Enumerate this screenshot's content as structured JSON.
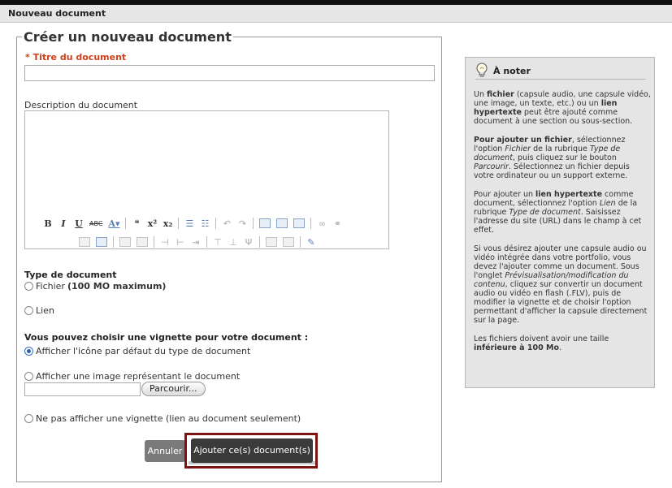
{
  "header": {
    "title": "Nouveau document"
  },
  "form": {
    "legend": "Créer un nouveau document",
    "title_label": "* Titre du document",
    "title_value": "",
    "description_label": "Description du document",
    "description_value": "",
    "doc_type": {
      "heading": "Type de document",
      "option_file": "Fichier",
      "option_file_note": "(100 MO maximum)",
      "option_link": "Lien"
    },
    "thumbnail": {
      "heading": "Vous pouvez choisir une vignette pour votre document :",
      "option_default": "Afficher l'icône par défaut du type de document",
      "option_image": "Afficher une image représentant le document",
      "browse_label": "Parcourir...",
      "option_none": "Ne pas afficher une vignette (lien au document seulement)",
      "selected": "option_default"
    },
    "cancel_label": "Annuler",
    "submit_label": "Ajouter ce(s) document(s)"
  },
  "toolbar": {
    "row1": [
      {
        "name": "bold-icon",
        "glyph": "B",
        "cls": "bold"
      },
      {
        "name": "italic-icon",
        "glyph": "I",
        "cls": "ital"
      },
      {
        "name": "underline-icon",
        "glyph": "U",
        "cls": "under"
      },
      {
        "name": "strikethrough-icon",
        "glyph": "ABC",
        "cls": "strike"
      },
      {
        "name": "font-color-icon",
        "glyph": "A▾",
        "cls": "under blue"
      },
      {
        "sep": true
      },
      {
        "name": "blockquote-icon",
        "glyph": "❝",
        "cls": ""
      },
      {
        "name": "superscript-icon",
        "glyph": "x²",
        "cls": "bold"
      },
      {
        "name": "subscript-icon",
        "glyph": "x₂",
        "cls": "bold"
      },
      {
        "sep": true
      },
      {
        "name": "bullet-list-icon",
        "glyph": "☰",
        "cls": "blue"
      },
      {
        "name": "numbered-list-icon",
        "glyph": "☷",
        "cls": "blue"
      },
      {
        "sep": true
      },
      {
        "name": "undo-icon",
        "glyph": "↶",
        "cls": "dim"
      },
      {
        "name": "redo-icon",
        "glyph": "↷",
        "cls": "dim"
      },
      {
        "sep": true
      },
      {
        "name": "paste-icon",
        "glyph": "",
        "cls": "icon"
      },
      {
        "name": "paste-text-icon",
        "glyph": "",
        "cls": "icon"
      },
      {
        "name": "paste-word-icon",
        "glyph": "",
        "cls": "icon"
      },
      {
        "sep": true
      },
      {
        "name": "link-icon",
        "glyph": "∞",
        "cls": "dim"
      },
      {
        "name": "unlink-icon",
        "glyph": "⚭",
        "cls": "dim"
      }
    ],
    "row2": [
      {
        "name": "insert-image-icon",
        "glyph": "",
        "cls": "icon dim"
      },
      {
        "name": "insert-media-icon",
        "glyph": "",
        "cls": "icon"
      },
      {
        "sep": true
      },
      {
        "name": "table-row-before-icon",
        "glyph": "",
        "cls": "icon dim"
      },
      {
        "name": "table-row-after-icon",
        "glyph": "",
        "cls": "icon dim"
      },
      {
        "sep": true
      },
      {
        "name": "table-col-before-icon",
        "glyph": "⊣",
        "cls": "dim"
      },
      {
        "name": "table-col-after-icon",
        "glyph": "⊢",
        "cls": "dim"
      },
      {
        "name": "table-delete-col-icon",
        "glyph": "⇥",
        "cls": "dim"
      },
      {
        "sep": true
      },
      {
        "name": "merge-cells-icon",
        "glyph": "⊤",
        "cls": "dim"
      },
      {
        "name": "split-cells-icon",
        "glyph": "⊥",
        "cls": "dim"
      },
      {
        "name": "table-props-icon",
        "glyph": "Ψ",
        "cls": "dim"
      },
      {
        "sep": true
      },
      {
        "name": "table-icon",
        "glyph": "",
        "cls": "icon dim"
      },
      {
        "name": "delete-table-icon",
        "glyph": "",
        "cls": "icon dim"
      },
      {
        "sep": true
      },
      {
        "name": "cleanup-icon",
        "glyph": "✎",
        "cls": "blue"
      }
    ]
  },
  "note": {
    "title": "À noter",
    "p1_a": "Un ",
    "p1_b": "fichier",
    "p1_c": " (capsule audio, une capsule vidéo, une image, un texte, etc.) ou un ",
    "p1_d": "lien hypertexte",
    "p1_e": " peut être ajouté comme document à une section ou sous-section.",
    "p2_a": "Pour ajouter un fichier",
    "p2_b": ", sélectionnez l'option ",
    "p2_c": "Fichier",
    "p2_d": " de la rubrique ",
    "p2_e": "Type de document",
    "p2_f": ", puis cliquez sur le bouton ",
    "p2_g": "Parcourir",
    "p2_h": ". Sélectionnez un fichier depuis votre ordinateur ou un support externe.",
    "p3_a": "Pour ajouter un ",
    "p3_b": "lien hypertexte",
    "p3_c": " comme document, sélectionnez l'option ",
    "p3_d": "Lien",
    "p3_e": " de la rubrique ",
    "p3_f": "Type de document",
    "p3_g": ". Saisissez l'adresse du site (URL) dans le champ à cet effet.",
    "p4_a": "Si vous désirez ajouter une capsule audio ou vidéo intégrée dans votre portfolio, vous devez l'ajouter comme un document. Sous l'onglet ",
    "p4_b": "Prévisualisation/modification du contenu",
    "p4_c": ", cliquez sur convertir un document audio ou vidéo en flash (.FLV), puis de modifier la vignette et de choisir l'option permettant d'afficher la capsule directement sur la page.",
    "p5_a": "Les fichiers doivent avoir une taille ",
    "p5_b": "inférieure à 100 Mo",
    "p5_c": "."
  }
}
